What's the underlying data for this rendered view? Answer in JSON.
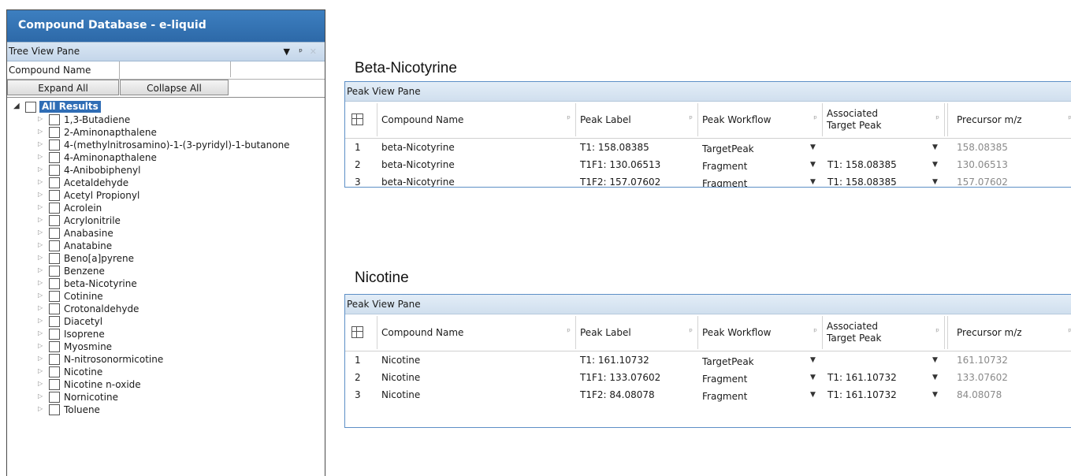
{
  "database": {
    "title": "Compound Database - e-liquid",
    "tree_pane_title": "Tree View Pane",
    "compound_name_label": "Compound Name",
    "compound_name_value": "",
    "expand_all": "Expand All",
    "collapse_all": "Collapse All",
    "root_label": "All Results",
    "items": [
      "1,3-Butadiene",
      "2-Aminonapthalene",
      "4-(methylnitrosamino)-1-(3-pyridyl)-1-butanone",
      "4-Aminonapthalene",
      "4-Anibobiphenyl",
      "Acetaldehyde",
      "Acetyl Propionyl",
      "Acrolein",
      "Acrylonitrile",
      "Anabasine",
      "Anatabine",
      "Beno[a]pyrene",
      "Benzene",
      "beta-Nicotyrine",
      "Cotinine",
      "Crotonaldehyde",
      "Diacetyl",
      "Isoprene",
      "Myosmine",
      "N-nitrosonormicotine",
      "Nicotine",
      "Nicotine n-oxide",
      "Nornicotine",
      "Toluene"
    ]
  },
  "tables": [
    {
      "title": "Beta-Nicotyrine",
      "pane_title": "Peak View Pane",
      "columns": [
        "Compound Name",
        "Peak Label",
        "Peak Workflow",
        "Associated Target Peak",
        "Precursor m/z"
      ],
      "rows": [
        {
          "n": "1",
          "compound": "beta-Nicotyrine",
          "label": "T1: 158.08385",
          "workflow": "TargetPeak",
          "assoc": "",
          "precursor": "158.08385"
        },
        {
          "n": "2",
          "compound": "beta-Nicotyrine",
          "label": "T1F1: 130.06513",
          "workflow": "Fragment",
          "assoc": "T1: 158.08385",
          "precursor": "130.06513"
        },
        {
          "n": "3",
          "compound": "beta-Nicotyrine",
          "label": "T1F2: 157.07602",
          "workflow": "Fragment",
          "assoc": "T1: 158.08385",
          "precursor": "157.07602"
        }
      ]
    },
    {
      "title": "Nicotine",
      "pane_title": "Peak View Pane",
      "columns": [
        "Compound Name",
        "Peak Label",
        "Peak Workflow",
        "Associated Target Peak",
        "Precursor m/z"
      ],
      "rows": [
        {
          "n": "1",
          "compound": "Nicotine",
          "label": "T1: 161.10732",
          "workflow": "TargetPeak",
          "assoc": "",
          "precursor": "161.10732"
        },
        {
          "n": "2",
          "compound": "Nicotine",
          "label": "T1F1: 133.07602",
          "workflow": "Fragment",
          "assoc": "T1: 161.10732",
          "precursor": "133.07602"
        },
        {
          "n": "3",
          "compound": "Nicotine",
          "label": "T1F2: 84.08078",
          "workflow": "Fragment",
          "assoc": "T1: 161.10732",
          "precursor": "84.08078"
        }
      ]
    }
  ],
  "colors": {
    "title_bar": "#2d69a8",
    "selection": "#2f6db5",
    "pane_border": "#5d8fc6"
  }
}
